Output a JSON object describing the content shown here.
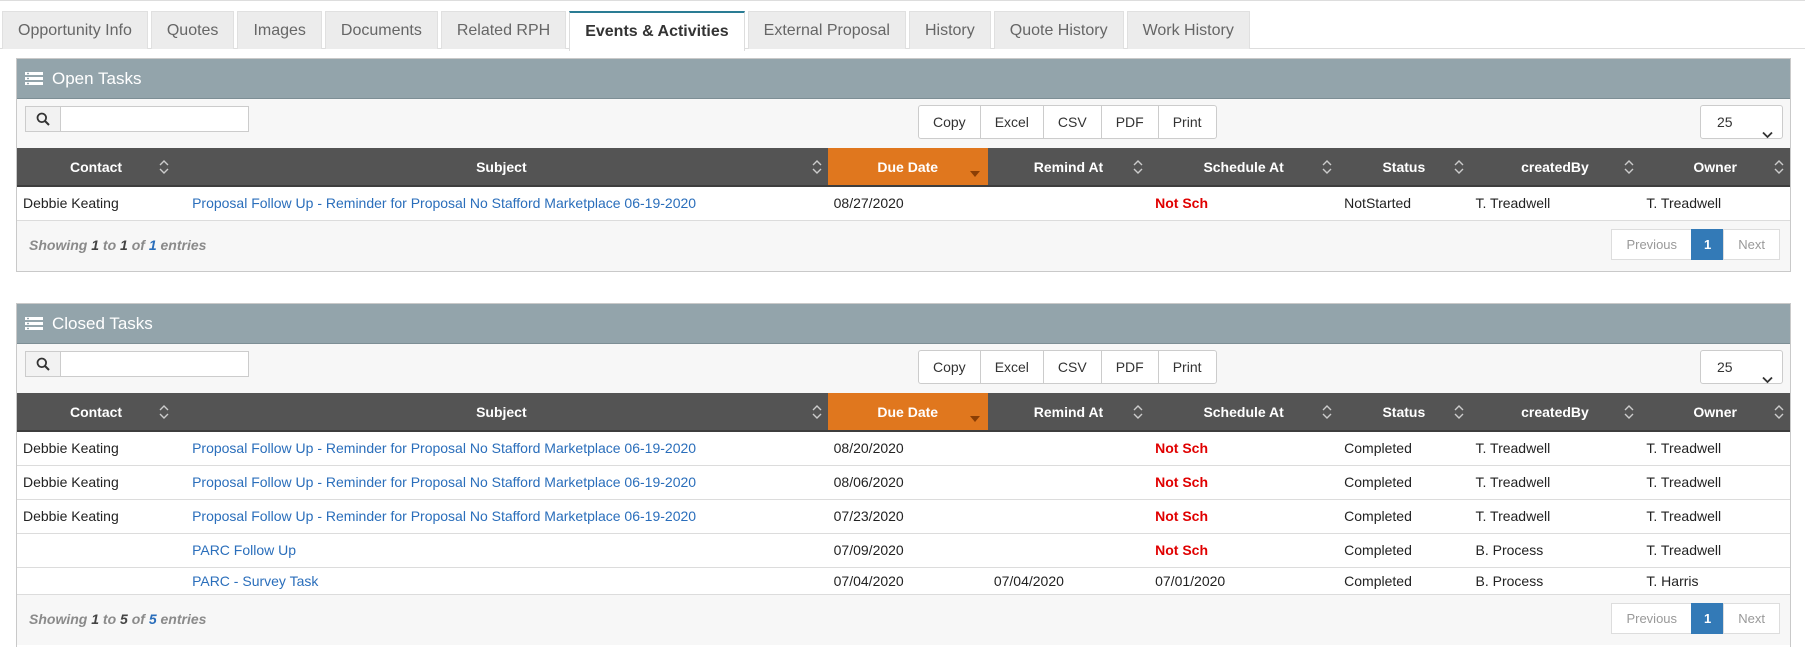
{
  "tabs": [
    "Opportunity Info",
    "Quotes",
    "Images",
    "Documents",
    "Related RPH",
    "Events & Activities",
    "External Proposal",
    "History",
    "Quote History",
    "Work History"
  ],
  "active_tab": "Events & Activities",
  "colors": {
    "panel_header": "#93a4ab",
    "table_header": "#545454",
    "sorted_column": "#e0771e",
    "link": "#2a6ebb",
    "not_scheduled": "#e00000",
    "pager_active": "#337ab7"
  },
  "open_tasks": {
    "title": "Open Tasks",
    "search_value": "",
    "buttons": [
      "Copy",
      "Excel",
      "CSV",
      "PDF",
      "Print"
    ],
    "page_size": "25",
    "columns": [
      "Contact",
      "Subject",
      "Due Date",
      "Remind At",
      "Schedule At",
      "Status",
      "createdBy",
      "Owner"
    ],
    "rows": [
      {
        "contact": "Debbie Keating",
        "subject": "Proposal Follow Up - Reminder for Proposal No Stafford Marketplace 06-19-2020",
        "due_date": "08/27/2020",
        "remind_at": "",
        "schedule_at": "Not Sch",
        "status": "NotStarted",
        "created_by": "T. Treadwell",
        "owner": "T. Treadwell"
      }
    ],
    "showing": {
      "prefix": "Showing",
      "from": "1",
      "to_word": "to",
      "to": "1",
      "of_word": "of",
      "total": "1",
      "suffix": "entries"
    },
    "pager": {
      "previous": "Previous",
      "page": "1",
      "next": "Next"
    }
  },
  "closed_tasks": {
    "title": "Closed Tasks",
    "search_value": "",
    "buttons": [
      "Copy",
      "Excel",
      "CSV",
      "PDF",
      "Print"
    ],
    "page_size": "25",
    "columns": [
      "Contact",
      "Subject",
      "Due Date",
      "Remind At",
      "Schedule At",
      "Status",
      "createdBy",
      "Owner"
    ],
    "rows": [
      {
        "contact": "Debbie Keating",
        "subject": "Proposal Follow Up - Reminder for Proposal No Stafford Marketplace 06-19-2020",
        "due_date": "08/20/2020",
        "remind_at": "",
        "schedule_at": "Not Sch",
        "status": "Completed",
        "created_by": "T. Treadwell",
        "owner": "T. Treadwell"
      },
      {
        "contact": "Debbie Keating",
        "subject": "Proposal Follow Up - Reminder for Proposal No Stafford Marketplace 06-19-2020",
        "due_date": "08/06/2020",
        "remind_at": "",
        "schedule_at": "Not Sch",
        "status": "Completed",
        "created_by": "T. Treadwell",
        "owner": "T. Treadwell"
      },
      {
        "contact": "Debbie Keating",
        "subject": "Proposal Follow Up - Reminder for Proposal No Stafford Marketplace 06-19-2020",
        "due_date": "07/23/2020",
        "remind_at": "",
        "schedule_at": "Not Sch",
        "status": "Completed",
        "created_by": "T. Treadwell",
        "owner": "T. Treadwell"
      },
      {
        "contact": "",
        "subject": "PARC Follow Up",
        "due_date": "07/09/2020",
        "remind_at": "",
        "schedule_at": "Not Sch",
        "status": "Completed",
        "created_by": "B. Process",
        "owner": "T. Treadwell"
      },
      {
        "contact": "",
        "subject": "PARC - Survey Task",
        "due_date": "07/04/2020",
        "remind_at": "07/04/2020",
        "schedule_at": "07/01/2020",
        "status": "Completed",
        "created_by": "B. Process",
        "owner": "T. Harris"
      }
    ],
    "showing": {
      "prefix": "Showing",
      "from": "1",
      "to_word": "to",
      "to": "5",
      "of_word": "of",
      "total": "5",
      "suffix": "entries"
    },
    "pager": {
      "previous": "Previous",
      "page": "1",
      "next": "Next"
    }
  }
}
